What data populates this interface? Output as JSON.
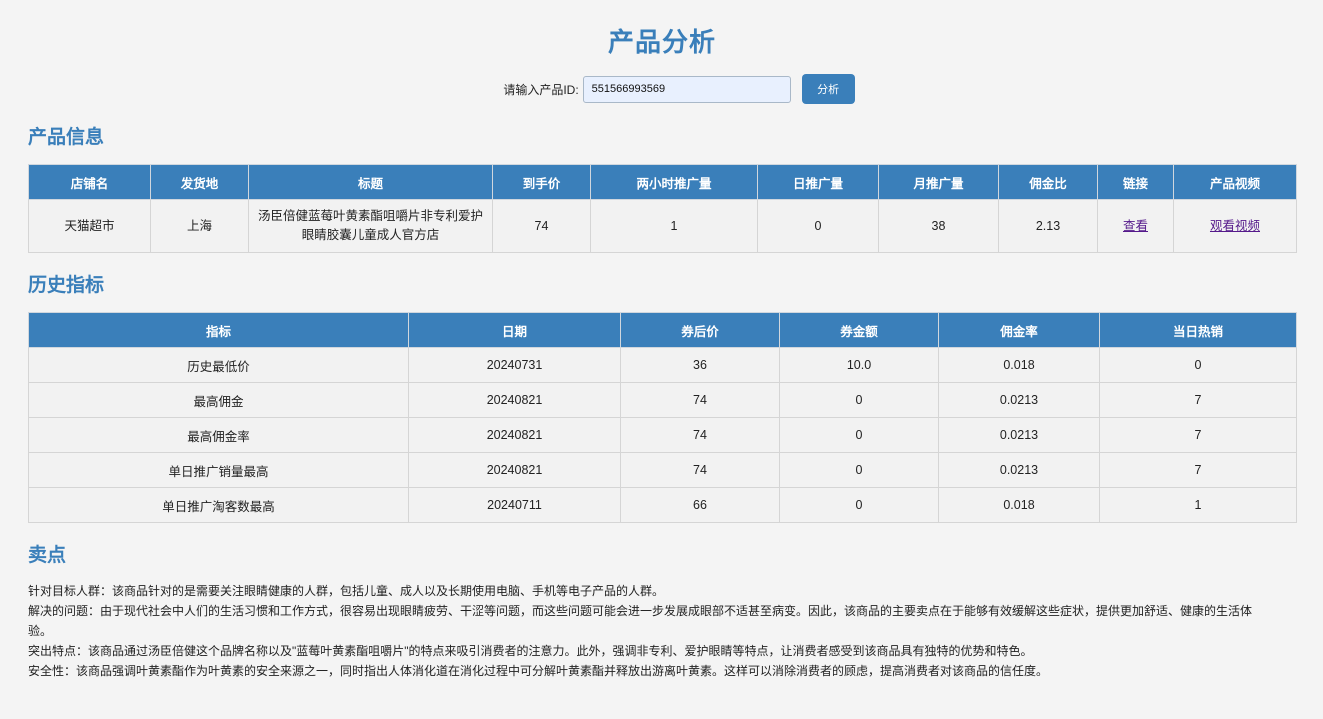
{
  "page_title": "产品分析",
  "search": {
    "label": "请输入产品ID:",
    "value": "551566993569",
    "button_label": "分析"
  },
  "product_info": {
    "section_title": "产品信息",
    "columns": [
      "店铺名",
      "发货地",
      "标题",
      "到手价",
      "两小时推广量",
      "日推广量",
      "月推广量",
      "佣金比",
      "链接",
      "产品视频"
    ],
    "row": {
      "shop": "天猫超市",
      "origin": "上海",
      "title": "汤臣倍健蓝莓叶黄素酯咀嚼片非专利爱护眼睛胶囊儿童成人官方店",
      "final_price": "74",
      "two_hour_promo": "1",
      "daily_promo": "0",
      "monthly_promo": "38",
      "commission_ratio": "2.13",
      "link_label": "查看",
      "video_label": "观看视频"
    }
  },
  "history": {
    "section_title": "历史指标",
    "columns": [
      "指标",
      "日期",
      "券后价",
      "券金额",
      "佣金率",
      "当日热销"
    ],
    "rows": [
      [
        "历史最低价",
        "20240731",
        "36",
        "10.0",
        "0.018",
        "0"
      ],
      [
        "最高佣金",
        "20240821",
        "74",
        "0",
        "0.0213",
        "7"
      ],
      [
        "最高佣金率",
        "20240821",
        "74",
        "0",
        "0.0213",
        "7"
      ],
      [
        "单日推广销量最高",
        "20240821",
        "74",
        "0",
        "0.0213",
        "7"
      ],
      [
        "单日推广淘客数最高",
        "20240711",
        "66",
        "0",
        "0.018",
        "1"
      ]
    ]
  },
  "selling_points": {
    "section_title": "卖点",
    "paragraphs": [
      "针对目标人群：该商品针对的是需要关注眼睛健康的人群，包括儿童、成人以及长期使用电脑、手机等电子产品的人群。",
      "解决的问题：由于现代社会中人们的生活习惯和工作方式，很容易出现眼睛疲劳、干涩等问题，而这些问题可能会进一步发展成眼部不适甚至病变。因此，该商品的主要卖点在于能够有效缓解这些症状，提供更加舒适、健康的生活体验。",
      "突出特点：该商品通过汤臣倍健这个品牌名称以及\"蓝莓叶黄素酯咀嚼片\"的特点来吸引消费者的注意力。此外，强调非专利、爱护眼睛等特点，让消费者感受到该商品具有独特的优势和特色。",
      "安全性：该商品强调叶黄素酯作为叶黄素的安全来源之一，同时指出人体消化道在消化过程中可分解叶黄素酯并释放出游离叶黄素。这样可以消除消费者的顾虑，提高消费者对该商品的信任度。"
    ]
  },
  "colors": {
    "accent": "#3a7fba",
    "link": "#551a8b",
    "background": "#f4f4f4"
  }
}
